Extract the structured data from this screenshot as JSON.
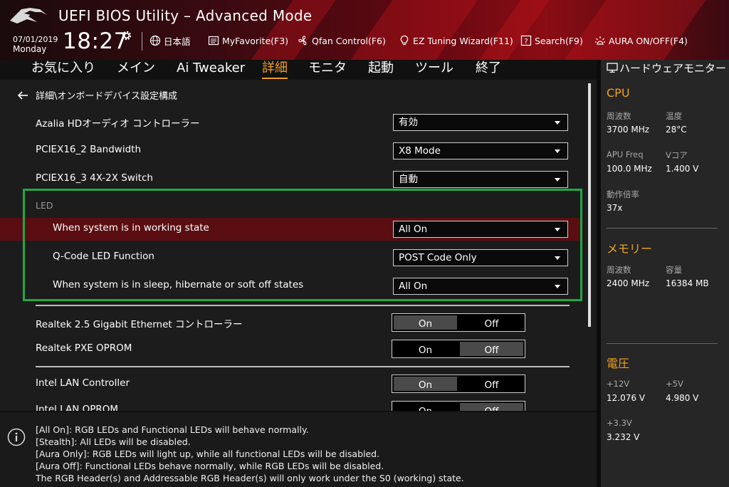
{
  "header": {
    "title": "UEFI BIOS Utility – Advanced Mode",
    "date": "07/01/2019",
    "day": "Monday",
    "time": "18:27",
    "language": "日本語",
    "myfavorite": "MyFavorite(F3)",
    "qfan": "Qfan Control(F6)",
    "ez_tuning": "EZ Tuning Wizard(F11)",
    "search": "Search(F9)",
    "aura": "AURA ON/OFF(F4)"
  },
  "menu": {
    "tabs": [
      "お気に入り",
      "メイン",
      "Ai Tweaker",
      "詳細",
      "モニタ",
      "起動",
      "ツール",
      "終了"
    ],
    "active": "詳細"
  },
  "breadcrumb": "詳細\\オンボードデバイス設定構成",
  "settings": {
    "azalia": {
      "label": "Azalia HDオーディオ コントローラー",
      "value": "有効"
    },
    "pciex16_2": {
      "label": "PCIEX16_2 Bandwidth",
      "value": "X8 Mode"
    },
    "pciex16_3": {
      "label": "PCIEX16_3 4X-2X Switch",
      "value": "自動"
    },
    "led_header": "LED",
    "led_working": {
      "label": "When system is in working state",
      "value": "All On"
    },
    "qcode": {
      "label": "Q-Code LED Function",
      "value": "POST Code Only"
    },
    "led_sleep": {
      "label": "When system is in sleep, hibernate or soft off states",
      "value": "All On"
    },
    "realtek_eth": {
      "label": "Realtek 2.5 Gigabit Ethernet コントローラー",
      "on": "On",
      "off": "Off",
      "selected": "On"
    },
    "realtek_pxe": {
      "label": "Realtek PXE OPROM",
      "on": "On",
      "off": "Off",
      "selected": "Off"
    },
    "intel_lan": {
      "label": "Intel LAN Controller",
      "on": "On",
      "off": "Off",
      "selected": "On"
    },
    "intel_oprom": {
      "label": "Intel LAN OPROM",
      "on": "On",
      "off": "Off",
      "selected": "Off"
    }
  },
  "help": [
    "[All On]: RGB LEDs and Functional LEDs will behave normally.",
    "[Stealth]: All LEDs will be disabled.",
    "[Aura Only]: RGB LEDs will light up, while all functional LEDs will be disabled.",
    "[Aura Off]: Functional LEDs behave normally, while RGB LEDs will be disabled.",
    "The RGB Header(s) and Addressable RGB Header(s) will only work under the S0 (working) state."
  ],
  "monitor": {
    "title": "ハードウェアモニター",
    "cpu": {
      "title": "CPU",
      "freq_label": "周波数",
      "freq_value": "3700 MHz",
      "temp_label": "温度",
      "temp_value": "28°C",
      "apu_label": "APU Freq",
      "apu_value": "100.0 MHz",
      "vcore_label": "Vコア",
      "vcore_value": "1.400 V",
      "ratio_label": "動作倍率",
      "ratio_value": "37x"
    },
    "memory": {
      "title": "メモリー",
      "freq_label": "周波数",
      "freq_value": "2400 MHz",
      "cap_label": "容量",
      "cap_value": "16384 MB"
    },
    "voltage": {
      "title": "電圧",
      "v12_label": "+12V",
      "v12_value": "12.076 V",
      "v5_label": "+5V",
      "v5_value": "4.980 V",
      "v33_label": "+3.3V",
      "v33_value": "3.232 V"
    }
  },
  "colors": {
    "accent": "#f0a020",
    "highlight_row": "#5a0e12",
    "annotation_box": "#22a844"
  }
}
